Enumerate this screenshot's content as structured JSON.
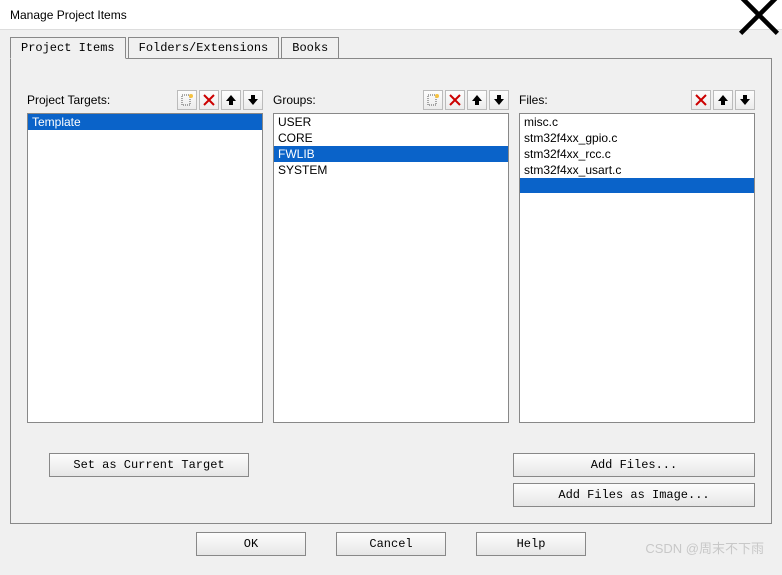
{
  "window": {
    "title": "Manage Project Items"
  },
  "tabs": {
    "t0": "Project Items",
    "t1": "Folders/Extensions",
    "t2": "Books"
  },
  "columns": {
    "targets": {
      "label": "Project Targets:"
    },
    "groups": {
      "label": "Groups:"
    },
    "files": {
      "label": "Files:"
    }
  },
  "targets": {
    "i0": "Template"
  },
  "groups": {
    "i0": "USER",
    "i1": "CORE",
    "i2": "FWLIB",
    "i3": "SYSTEM"
  },
  "files": {
    "i0": "misc.c",
    "i1": "stm32f4xx_gpio.c",
    "i2": "stm32f4xx_rcc.c",
    "i3": "stm32f4xx_usart.c"
  },
  "buttons": {
    "set_target": "Set as Current Target",
    "add_files": "Add Files...",
    "add_image": "Add Files as Image...",
    "ok": "OK",
    "cancel": "Cancel",
    "help": "Help"
  },
  "watermark": "CSDN @周末不下雨"
}
